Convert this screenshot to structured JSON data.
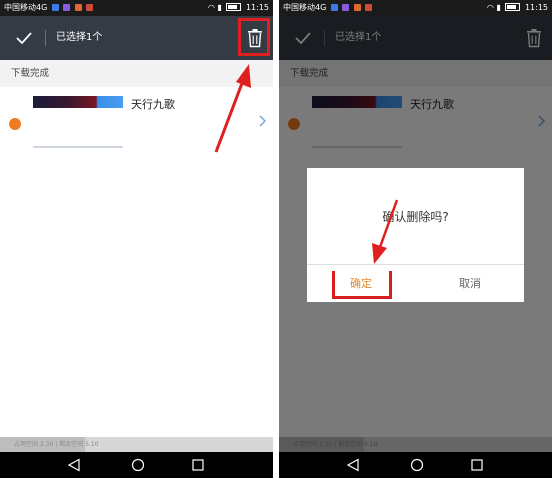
{
  "status_bar": {
    "carrier": "中国移动4G",
    "time": "11:15"
  },
  "toolbar": {
    "selected_label": "已选择1个"
  },
  "section": {
    "title": "下载完成"
  },
  "download_item": {
    "title": "天行九歌"
  },
  "storage": {
    "used_label": "占用空间",
    "used_value": "2.30",
    "separator": "|",
    "free_label": "剩余空间",
    "free_value": "5.10",
    "used_fraction": 0.31
  },
  "dialog": {
    "message": "确认删除吗?",
    "confirm_label": "确定",
    "cancel_label": "取消"
  },
  "colors": {
    "toolbar_bg": "#353b44",
    "accent_orange": "#f07b20",
    "highlight_red": "#e02020"
  },
  "icons": {
    "toolbar_check": "check-icon",
    "toolbar_delete": "trash-icon",
    "row_chevron": "chevron-right-icon"
  }
}
